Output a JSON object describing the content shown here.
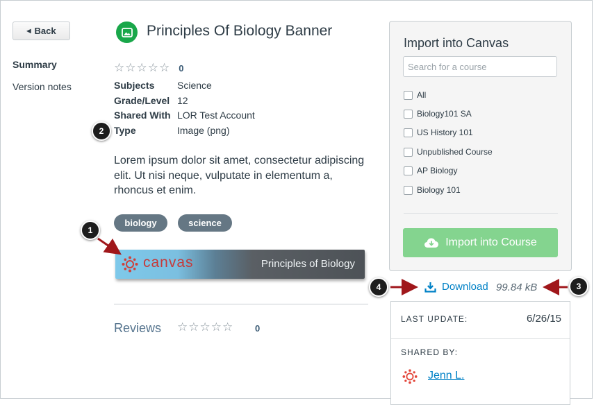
{
  "nav": {
    "back_label": "Back",
    "summary_label": "Summary",
    "version_notes_label": "Version notes"
  },
  "resource": {
    "title": "Principles Of Biology Banner",
    "rating_count": "0",
    "meta": [
      {
        "key": "Subjects",
        "value": "Science"
      },
      {
        "key": "Grade/Level",
        "value": "12"
      },
      {
        "key": "Shared With",
        "value": "LOR Test Account"
      },
      {
        "key": "Type",
        "value": "Image (png)"
      }
    ],
    "description": "Lorem ipsum dolor sit amet, consectetur adipiscing elit. Ut nisi neque, vulputate in elementum a, rhoncus et enim.",
    "tags": [
      "biology",
      "science"
    ],
    "banner": {
      "brand": "canvas",
      "subtitle": "Principles of Biology"
    }
  },
  "reviews": {
    "label": "Reviews",
    "count": "0"
  },
  "import_panel": {
    "title": "Import into Canvas",
    "search_placeholder": "Search for a course",
    "courses": [
      "All",
      "Biology101 SA",
      "US History 101",
      "Unpublished Course",
      "AP Biology",
      "Biology 101"
    ],
    "button_label": "Import into Course"
  },
  "download": {
    "label": "Download",
    "size": "99.84 kB"
  },
  "info": {
    "last_update_label": "LAST UPDATE:",
    "last_update_value": "6/26/15",
    "shared_by_label": "SHARED BY:",
    "shared_by_name": "Jenn L."
  },
  "callouts": [
    "1",
    "2",
    "3",
    "4"
  ],
  "colors": {
    "accent_green": "#19a74a",
    "import_button": "#84d48f",
    "link_blue": "#0081c6",
    "tag_bg": "#657784",
    "callout_arrow": "#a0171b"
  }
}
